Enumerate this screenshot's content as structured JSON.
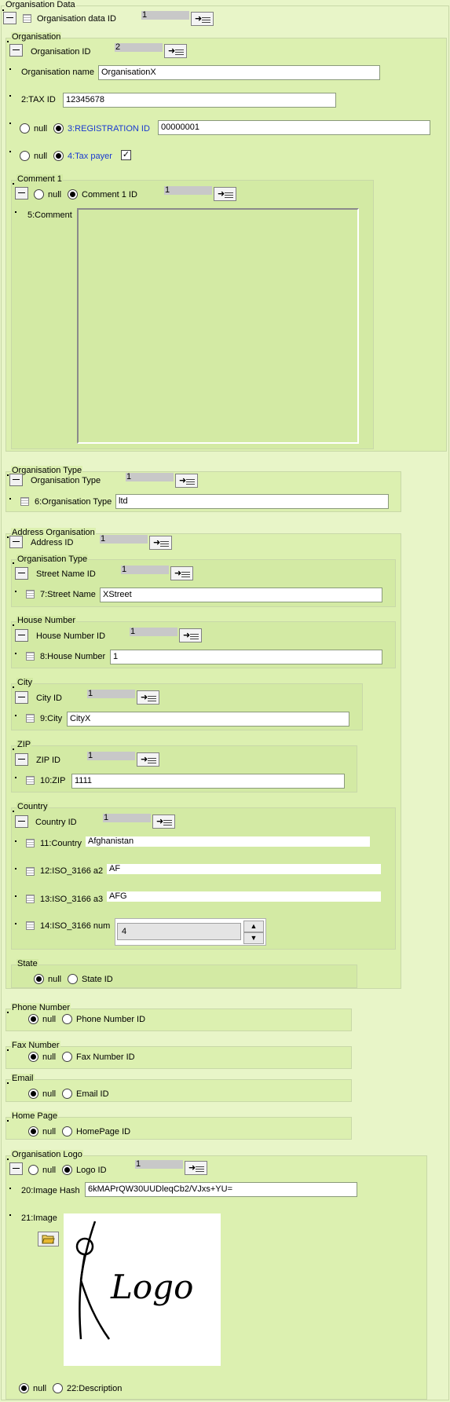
{
  "org_data": {
    "legend": "Organisation Data",
    "id_label": "Organisation data ID",
    "id_value": "1"
  },
  "organisation": {
    "legend": "Organisation",
    "id_label": "Organisation ID",
    "id_value": "2",
    "name_label": "Organisation name",
    "name_value": "OrganisationX",
    "tax_label": "2:TAX ID",
    "tax_value": "12345678",
    "reg_null_label": "null",
    "reg_label": "3:REGISTRATION ID",
    "reg_value": "00000001",
    "taxpayer_null_label": "null",
    "taxpayer_label": "4:Tax payer",
    "taxpayer_check": "✓"
  },
  "comment1": {
    "legend": "Comment 1",
    "null_label": "null",
    "id_label": "Comment 1 ID",
    "id_value": "1",
    "comment_label": "5:Comment",
    "comment_value": ""
  },
  "org_type": {
    "legend": "Organisation Type",
    "id_label": "Organisation Type",
    "id_value": "1",
    "type_label": "6:Organisation Type",
    "type_value": "ltd"
  },
  "address": {
    "legend": "Address Organisation",
    "id_label": "Address ID",
    "id_value": "1",
    "street": {
      "legend": "Organisation Type",
      "id_label": "Street Name ID",
      "id_value": "1",
      "field_label": "7:Street Name",
      "field_value": "XStreet"
    },
    "house": {
      "legend": "House Number",
      "id_label": "House Number ID",
      "id_value": "1",
      "field_label": "8:House Number",
      "field_value": "1"
    },
    "city": {
      "legend": "City",
      "id_label": "City ID",
      "id_value": "1",
      "field_label": "9:City",
      "field_value": "CityX"
    },
    "zip": {
      "legend": "ZIP",
      "id_label": "ZIP ID",
      "id_value": "1",
      "field_label": "10:ZIP",
      "field_value": "1111"
    },
    "country": {
      "legend": "Country",
      "id_label": "Country ID",
      "id_value": "1",
      "country_label": "11:Country",
      "country_value": "Afghanistan",
      "a2_label": "12:ISO_3166 a2",
      "a2_value": "AF",
      "a3_label": "13:ISO_3166 a3",
      "a3_value": "AFG",
      "num_label": "14:ISO_3166 num",
      "num_value": "4"
    },
    "state": {
      "legend": "State",
      "null_label": "null",
      "id_label": "State ID"
    }
  },
  "phone": {
    "legend": "Phone Number",
    "null_label": "null",
    "id_label": "Phone Number ID"
  },
  "fax": {
    "legend": "Fax Number",
    "null_label": "null",
    "id_label": "Fax Number ID"
  },
  "email": {
    "legend": "Email",
    "null_label": "null",
    "id_label": "Email ID"
  },
  "homepage": {
    "legend": "Home Page",
    "null_label": "null",
    "id_label": "HomePage ID"
  },
  "logo": {
    "legend": "Organisation Logo",
    "null_label": "null",
    "id_label": "Logo ID",
    "id_value": "1",
    "hash_label": "20:Image Hash",
    "hash_value": "6kMAPrQW30UUDleqCb2/VJxs+YU=",
    "image_label": "21:Image",
    "image_text": "Logo",
    "desc_null_label": "null",
    "desc_label": "22:Description"
  },
  "colors": {
    "outer_bg": "#e8f5c8",
    "inner_bg": "#dcf0b0",
    "nested_bg": "#d3eaa4",
    "link_blue": "#1a3ad0"
  }
}
